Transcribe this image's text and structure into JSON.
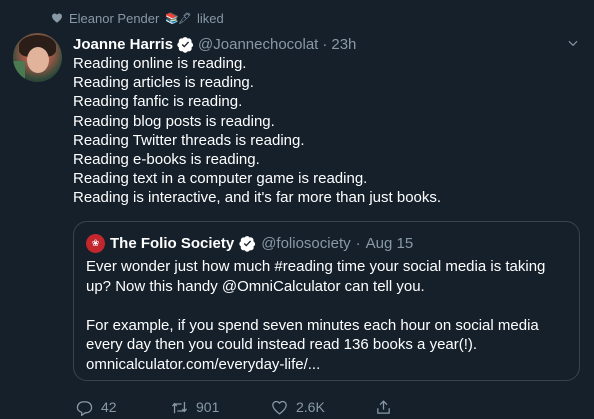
{
  "social_context": {
    "user": "Eleanor Pender",
    "emoji": "📚🖋",
    "action": "liked"
  },
  "tweet": {
    "display_name": "Joanne Harris",
    "handle": "@Joannechocolat",
    "separator": "·",
    "time": "23h",
    "lines": [
      "Reading online is reading.",
      "Reading articles is reading.",
      "Reading fanfic is reading.",
      "Reading blog posts is reading.",
      "Reading Twitter threads is reading.",
      "Reading e-books is reading.",
      "Reading text in a computer game is reading.",
      "Reading is interactive, and it's far more than just books."
    ]
  },
  "quote": {
    "display_name": "The Folio Society",
    "handle": "@foliosociety",
    "separator": "·",
    "time": "Aug 15",
    "lines": [
      "Ever wonder just how much #reading time your social media is taking",
      "up? Now this handy @OmniCalculator can tell you.",
      "",
      "For example, if you spend seven minutes each hour on social media",
      "every day then you could instead read 136 books a year(!).",
      "omnicalculator.com/everyday-life/..."
    ]
  },
  "actions": {
    "replies": "42",
    "retweets": "901",
    "likes": "2.6K"
  },
  "colors": {
    "background": "#15202b",
    "secondary_text": "#8899a6",
    "border": "#38444d",
    "verified": "#ffffff"
  }
}
